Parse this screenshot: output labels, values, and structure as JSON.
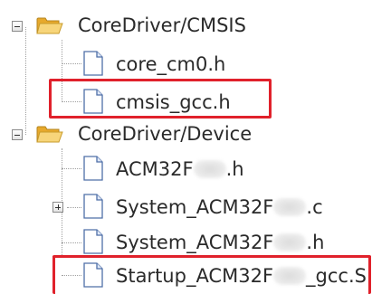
{
  "tree": {
    "groups": [
      {
        "label": "CoreDriver/CMSIS",
        "expanded": true,
        "files": [
          {
            "label": "core_cm0.h",
            "highlighted": false,
            "has_children": false
          },
          {
            "label": "cmsis_gcc.h",
            "highlighted": true,
            "has_children": false
          }
        ]
      },
      {
        "label": "CoreDriver/Device",
        "expanded": true,
        "files": [
          {
            "label_prefix": "ACM32F",
            "label_suffix": ".h",
            "highlighted": false,
            "has_children": false
          },
          {
            "label_prefix": "System_ACM32F",
            "label_suffix": ".c",
            "highlighted": false,
            "has_children": true
          },
          {
            "label_prefix": "System_ACM32F",
            "label_suffix": ".h",
            "highlighted": false,
            "has_children": false
          },
          {
            "label_prefix": "Startup_ACM32F",
            "label_suffix": "_gcc.S",
            "highlighted": true,
            "has_children": false
          }
        ]
      }
    ]
  },
  "colors": {
    "highlight_border": "#e0212b",
    "folder": "#f2c14e",
    "file_fold": "#5a8fd6",
    "tree_line": "#a0a0a0"
  },
  "icons": {
    "folder": "folder-open-icon",
    "file": "file-icon",
    "collapse": "collapse-icon",
    "expand": "expand-icon"
  }
}
